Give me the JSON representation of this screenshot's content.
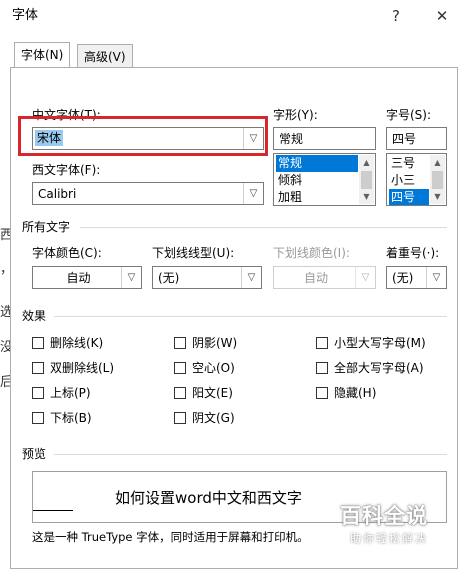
{
  "window": {
    "title": "字体",
    "help_label": "?",
    "close_label": "✕"
  },
  "tabs": [
    {
      "label": "字体(N)"
    },
    {
      "label": "高级(V)"
    }
  ],
  "font": {
    "chinese_label": "中文字体(T):",
    "chinese_value": "宋体",
    "western_label": "西文字体(F):",
    "western_value": "Calibri",
    "style_label": "字形(Y):",
    "style_value": "常规",
    "style_options": [
      "常规",
      "倾斜",
      "加粗"
    ],
    "size_label": "字号(S):",
    "size_value": "四号",
    "size_options": [
      "三号",
      "小三",
      "四号"
    ]
  },
  "all_text": {
    "section_label": "所有文字",
    "color_label": "字体颜色(C):",
    "color_value": "自动",
    "underline_label": "下划线线型(U):",
    "underline_value": "(无)",
    "underline_color_label": "下划线颜色(I):",
    "underline_color_value": "自动",
    "emphasis_label": "着重号(·):",
    "emphasis_value": "(无)"
  },
  "effects": {
    "section_label": "效果",
    "items": [
      {
        "label": "删除线(K)"
      },
      {
        "label": "双删除线(L)"
      },
      {
        "label": "上标(P)"
      },
      {
        "label": "下标(B)"
      },
      {
        "label": "阴影(W)"
      },
      {
        "label": "空心(O)"
      },
      {
        "label": "阳文(E)"
      },
      {
        "label": "阴文(G)"
      },
      {
        "label": "小型大写字母(M)"
      },
      {
        "label": "全部大写字母(A)"
      },
      {
        "label": "隐藏(H)"
      }
    ]
  },
  "preview": {
    "section_label": "预览",
    "sample_text": "如何设置word中文和西文字",
    "note": "这是一种 TrueType 字体，同时适用于屏幕和打印机。"
  },
  "watermark": {
    "title": "百科全说",
    "subtitle": "助你轻松解决"
  },
  "background_glyphs": [
    "西",
    "，",
    "选",
    "没",
    "后"
  ],
  "colors": {
    "highlight_box": "#d9262d",
    "selection": "#0078d7",
    "watermark": "#ffffff"
  }
}
